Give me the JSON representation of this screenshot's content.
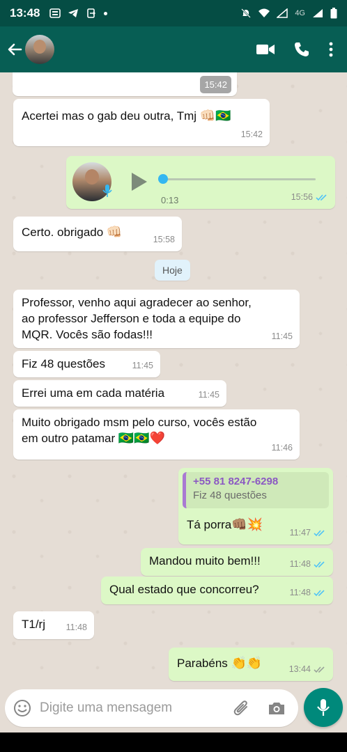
{
  "status_bar": {
    "time": "13:48",
    "network": "4G"
  },
  "chat_header": {
    "back_icon": "arrow-back-icon",
    "actions": [
      "video-call-icon",
      "phone-icon",
      "more-vert-icon"
    ]
  },
  "messages": [
    {
      "id": "m0",
      "direction": "incoming",
      "text": "",
      "time": "15:42"
    },
    {
      "id": "m1",
      "direction": "incoming",
      "text": "Acertei mas o gab deu outra, Tmj",
      "emoji": "👊🏻🇧🇷",
      "time": "15:42"
    },
    {
      "id": "m2",
      "direction": "outgoing",
      "type": "voice",
      "duration": "0:13",
      "time": "15:56",
      "progress": 0.0,
      "status": "read"
    },
    {
      "id": "m3",
      "direction": "incoming",
      "text": "Certo. obrigado",
      "emoji": "👊🏻",
      "time": "15:58"
    },
    {
      "id": "m4",
      "direction": "incoming",
      "lines": [
        "Professor, venho aqui agradecer ao senhor,",
        "ao professor Jefferson e toda a equipe do",
        "MQR. Vocês são fodas!!!"
      ],
      "time": "11:45"
    },
    {
      "id": "m5",
      "direction": "incoming",
      "text": "Fiz 48 questões",
      "time": "11:45"
    },
    {
      "id": "m6",
      "direction": "incoming",
      "text": "Errei uma em cada matéria",
      "time": "11:45"
    },
    {
      "id": "m7",
      "direction": "incoming",
      "lines": [
        "Muito obrigado msm pelo curso, vocês estão",
        "em outro patamar"
      ],
      "emoji": "🇧🇷🇧🇷❤️",
      "time": "11:46"
    },
    {
      "id": "m8",
      "direction": "outgoing",
      "quote": {
        "author": "+55 81 8247-6298",
        "text": "Fiz 48 questões"
      },
      "text": "Tá porra",
      "emoji": "👊🏽💥",
      "time": "11:47",
      "status": "read"
    },
    {
      "id": "m9",
      "direction": "outgoing",
      "text": "Mandou muito bem!!!",
      "time": "11:48",
      "status": "read"
    },
    {
      "id": "m10",
      "direction": "outgoing",
      "text": "Qual estado que concorreu?",
      "time": "11:48",
      "status": "read"
    },
    {
      "id": "m11",
      "direction": "incoming",
      "text": "T1/rj",
      "time": "11:48"
    },
    {
      "id": "m12",
      "direction": "outgoing",
      "text": "Parabéns",
      "emoji": "👏👏",
      "time": "13:44",
      "status": "delivered"
    }
  ],
  "date_divider": "Hoje",
  "composer": {
    "placeholder": "Digite uma mensagem",
    "value": "",
    "icons": [
      "emoji-icon",
      "attach-icon",
      "camera-icon"
    ],
    "send_icon": "microphone-icon"
  },
  "colors": {
    "header": "#075e54",
    "status_bar": "#054d44",
    "outgoing_bubble": "#dcf8c6",
    "incoming_bubble": "#ffffff",
    "read_ticks": "#4fc3f7",
    "fab": "#00897b"
  }
}
